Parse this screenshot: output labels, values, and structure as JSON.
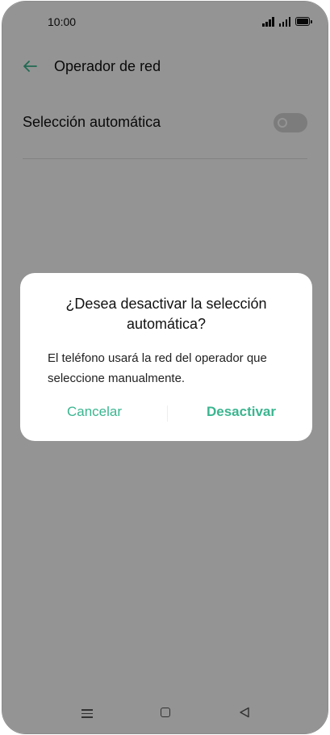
{
  "status_bar": {
    "time": "10:00"
  },
  "app_bar": {
    "title": "Operador de red",
    "back_icon": "arrow-left-icon"
  },
  "settings": {
    "auto_selection": {
      "label": "Selección automática",
      "enabled": true
    }
  },
  "dialog": {
    "title": "¿Desea desactivar la selección automática?",
    "message": "El teléfono usará la red del operador que seleccione manualmente.",
    "cancel_label": "Cancelar",
    "confirm_label": "Desactivar"
  },
  "colors": {
    "accent": "#3bb58f",
    "scrim": "#000000"
  },
  "nav_bar": {
    "icons": [
      "menu-icon",
      "home-icon",
      "back-triangle-icon"
    ]
  }
}
